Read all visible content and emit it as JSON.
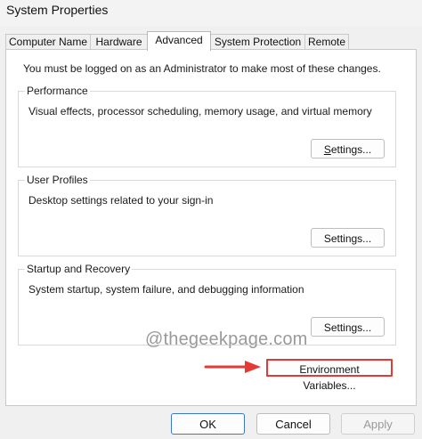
{
  "window": {
    "title": "System Properties"
  },
  "tabs": [
    {
      "label": "Computer Name"
    },
    {
      "label": "Hardware"
    },
    {
      "label": "Advanced",
      "active": true
    },
    {
      "label": "System Protection"
    },
    {
      "label": "Remote"
    }
  ],
  "admin_note": "You must be logged on as an Administrator to make most of these changes.",
  "groups": {
    "performance": {
      "title": "Performance",
      "description": "Visual effects, processor scheduling, memory usage, and virtual memory",
      "button": "Settings..."
    },
    "user_profiles": {
      "title": "User Profiles",
      "description": "Desktop settings related to your sign-in",
      "button": "Settings..."
    },
    "startup_recovery": {
      "title": "Startup and Recovery",
      "description": "System startup, system failure, and debugging information",
      "button": "Settings..."
    }
  },
  "env_button": "Environment Variables...",
  "watermark": "@thegeekpage.com",
  "footer": {
    "ok": "OK",
    "cancel": "Cancel",
    "apply": "Apply"
  },
  "colors": {
    "highlight": "#e53935",
    "accent": "#3c78c9"
  }
}
